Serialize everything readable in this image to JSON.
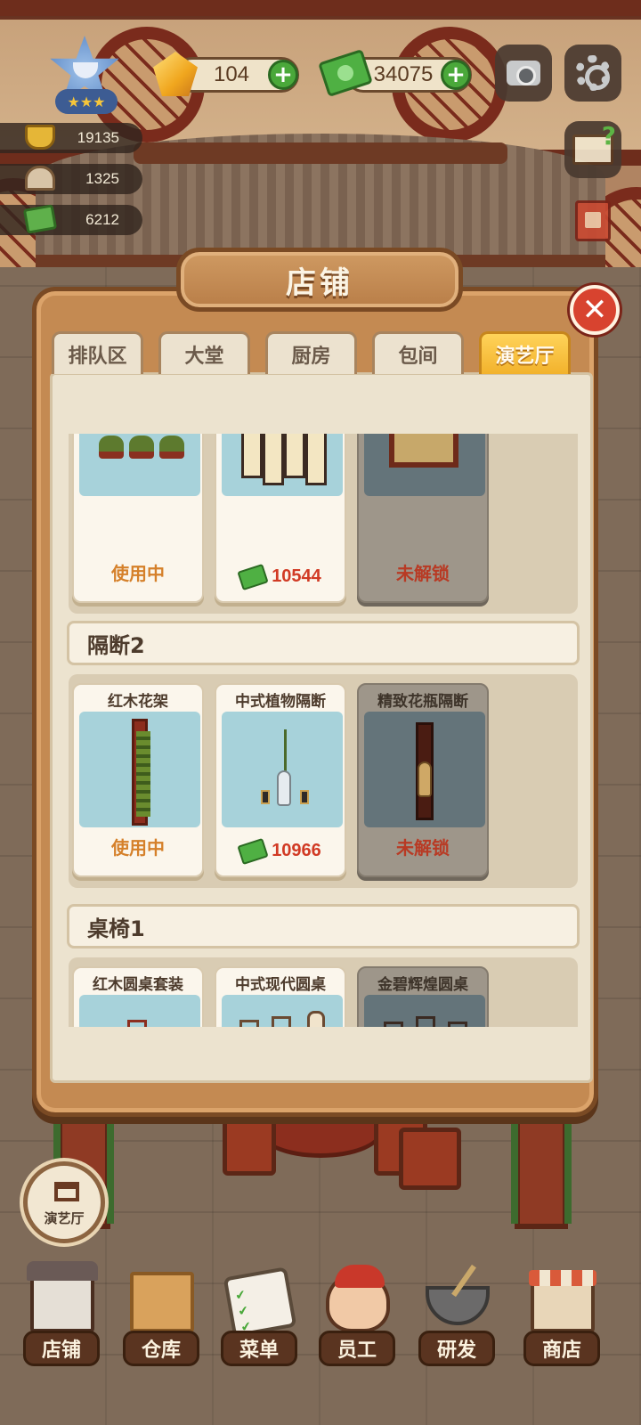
{
  "hud": {
    "gems": "104",
    "cash": "34075",
    "stats": [
      {
        "icon": "gold-pot-icon",
        "value": "19135"
      },
      {
        "icon": "dish-cloche-icon",
        "value": "1325"
      },
      {
        "icon": "menu-tray-icon",
        "value": "6212"
      }
    ],
    "rank_stars": "★★★"
  },
  "panel": {
    "title": "店铺",
    "tabs": [
      "排队区",
      "大堂",
      "厨房",
      "包间",
      "演艺厅"
    ],
    "active_tab": "演艺厅"
  },
  "sections": [
    {
      "header": "",
      "items": [
        {
          "name": "",
          "status": "使用中",
          "state": "in-use"
        },
        {
          "name": "",
          "price": "10544",
          "state": "buy"
        },
        {
          "name": "",
          "status": "未解锁",
          "state": "locked"
        }
      ]
    },
    {
      "header": "隔断2",
      "items": [
        {
          "name": "红木花架",
          "status": "使用中",
          "state": "in-use"
        },
        {
          "name": "中式植物隔断",
          "price": "10966",
          "state": "buy"
        },
        {
          "name": "精致花瓶隔断",
          "status": "未解锁",
          "state": "locked"
        }
      ]
    },
    {
      "header": "桌椅1",
      "items": [
        {
          "name": "红木圆桌套装",
          "state": "partial"
        },
        {
          "name": "中式现代圆桌",
          "state": "partial"
        },
        {
          "name": "金碧辉煌圆桌",
          "state": "partial"
        }
      ]
    }
  ],
  "location": {
    "label": "演艺厅"
  },
  "bottom_nav": [
    {
      "label": "店铺",
      "icon": "storefront-icon"
    },
    {
      "label": "仓库",
      "icon": "boxes-icon"
    },
    {
      "label": "菜单",
      "icon": "clipboard-icon"
    },
    {
      "label": "员工",
      "icon": "staff-icon"
    },
    {
      "label": "研发",
      "icon": "wok-icon"
    },
    {
      "label": "商店",
      "icon": "shop-icon"
    }
  ],
  "colors": {
    "accent_active_tab": "#f2b22c",
    "price_red": "#d13a24",
    "in_use_orange": "#d5802a",
    "close_red": "#d8432f"
  }
}
